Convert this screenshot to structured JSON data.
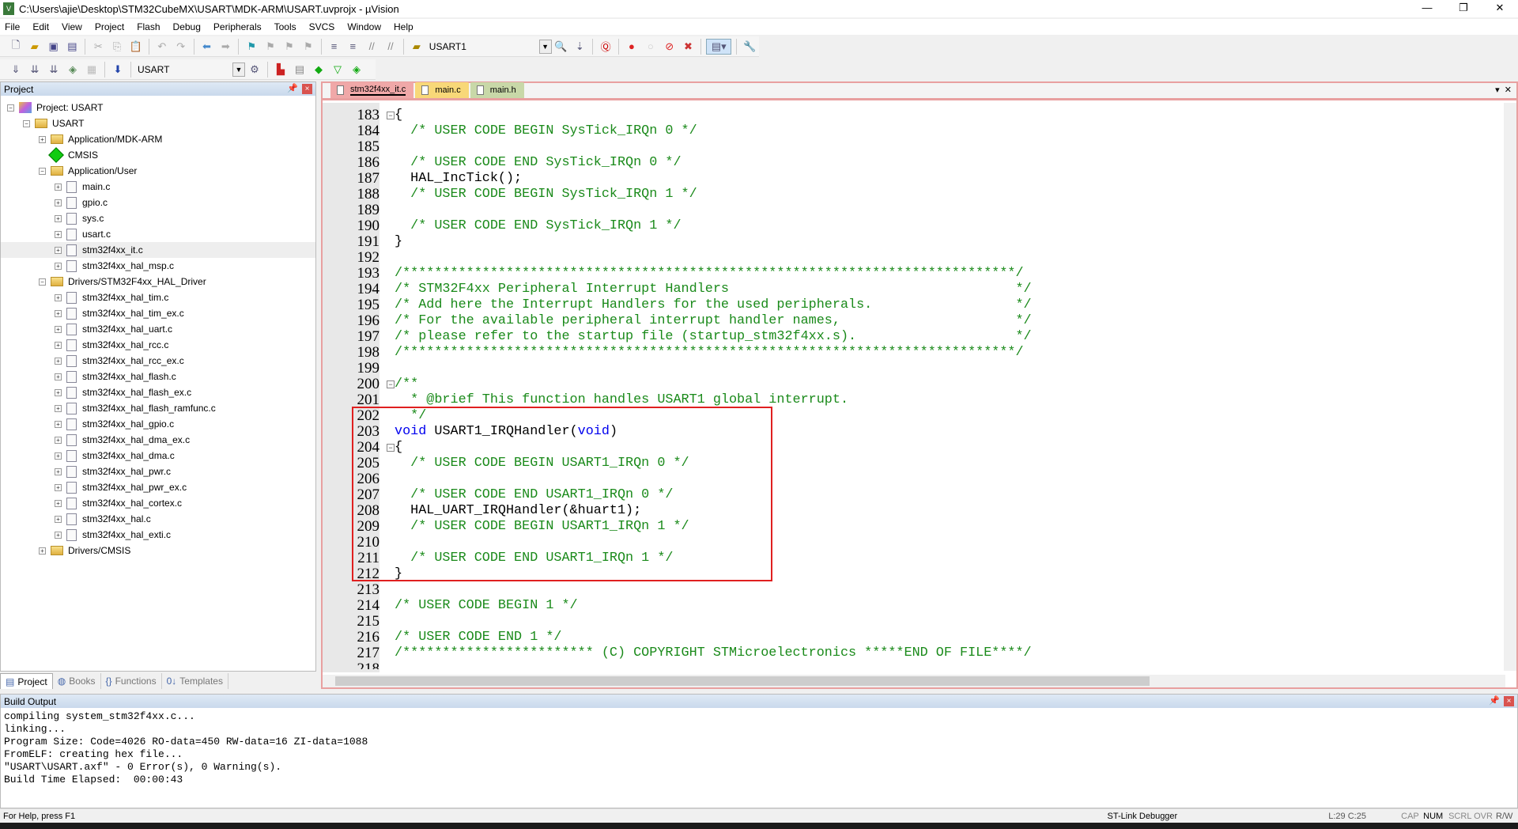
{
  "window": {
    "title": "C:\\Users\\ajie\\Desktop\\STM32CubeMX\\USART\\MDK-ARM\\USART.uvprojx - µVision",
    "minimize": "—",
    "restore": "❐",
    "close": "✕"
  },
  "menu": [
    "File",
    "Edit",
    "View",
    "Project",
    "Flash",
    "Debug",
    "Peripherals",
    "Tools",
    "SVCS",
    "Window",
    "Help"
  ],
  "toolbar1": {
    "target_find": "USART1"
  },
  "toolbar2": {
    "target": "USART"
  },
  "project_panel": {
    "title": "Project",
    "tree": [
      {
        "label": "Project: USART",
        "level": 0,
        "icon": "project",
        "exp": "−"
      },
      {
        "label": "USART",
        "level": 1,
        "icon": "folder",
        "exp": "−"
      },
      {
        "label": "Application/MDK-ARM",
        "level": 2,
        "icon": "folder",
        "exp": "+"
      },
      {
        "label": "CMSIS",
        "level": 2,
        "icon": "cmsis",
        "exp": ""
      },
      {
        "label": "Application/User",
        "level": 2,
        "icon": "folder",
        "exp": "−"
      },
      {
        "label": "main.c",
        "level": 3,
        "icon": "file",
        "exp": "+"
      },
      {
        "label": "gpio.c",
        "level": 3,
        "icon": "file",
        "exp": "+"
      },
      {
        "label": "sys.c",
        "level": 3,
        "icon": "file",
        "exp": "+"
      },
      {
        "label": "usart.c",
        "level": 3,
        "icon": "file",
        "exp": "+"
      },
      {
        "label": "stm32f4xx_it.c",
        "level": 3,
        "icon": "file",
        "exp": "+",
        "selected": true
      },
      {
        "label": "stm32f4xx_hal_msp.c",
        "level": 3,
        "icon": "file",
        "exp": "+"
      },
      {
        "label": "Drivers/STM32F4xx_HAL_Driver",
        "level": 2,
        "icon": "folder",
        "exp": "−"
      },
      {
        "label": "stm32f4xx_hal_tim.c",
        "level": 3,
        "icon": "file",
        "exp": "+"
      },
      {
        "label": "stm32f4xx_hal_tim_ex.c",
        "level": 3,
        "icon": "file",
        "exp": "+"
      },
      {
        "label": "stm32f4xx_hal_uart.c",
        "level": 3,
        "icon": "file",
        "exp": "+"
      },
      {
        "label": "stm32f4xx_hal_rcc.c",
        "level": 3,
        "icon": "file",
        "exp": "+"
      },
      {
        "label": "stm32f4xx_hal_rcc_ex.c",
        "level": 3,
        "icon": "file",
        "exp": "+"
      },
      {
        "label": "stm32f4xx_hal_flash.c",
        "level": 3,
        "icon": "file",
        "exp": "+"
      },
      {
        "label": "stm32f4xx_hal_flash_ex.c",
        "level": 3,
        "icon": "file",
        "exp": "+"
      },
      {
        "label": "stm32f4xx_hal_flash_ramfunc.c",
        "level": 3,
        "icon": "file",
        "exp": "+"
      },
      {
        "label": "stm32f4xx_hal_gpio.c",
        "level": 3,
        "icon": "file",
        "exp": "+"
      },
      {
        "label": "stm32f4xx_hal_dma_ex.c",
        "level": 3,
        "icon": "file",
        "exp": "+"
      },
      {
        "label": "stm32f4xx_hal_dma.c",
        "level": 3,
        "icon": "file",
        "exp": "+"
      },
      {
        "label": "stm32f4xx_hal_pwr.c",
        "level": 3,
        "icon": "file",
        "exp": "+"
      },
      {
        "label": "stm32f4xx_hal_pwr_ex.c",
        "level": 3,
        "icon": "file",
        "exp": "+"
      },
      {
        "label": "stm32f4xx_hal_cortex.c",
        "level": 3,
        "icon": "file",
        "exp": "+"
      },
      {
        "label": "stm32f4xx_hal.c",
        "level": 3,
        "icon": "file",
        "exp": "+"
      },
      {
        "label": "stm32f4xx_hal_exti.c",
        "level": 3,
        "icon": "file",
        "exp": "+"
      },
      {
        "label": "Drivers/CMSIS",
        "level": 2,
        "icon": "folder",
        "exp": "+"
      }
    ]
  },
  "bottom_tabs": [
    {
      "icon": "▤",
      "label": "Project"
    },
    {
      "icon": "◍",
      "label": "Books"
    },
    {
      "icon": "{}",
      "label": "Functions"
    },
    {
      "icon": "0↓",
      "label": "Templates"
    }
  ],
  "editor": {
    "tabs": [
      {
        "label": "stm32f4xx_it.c",
        "color": "#f0a8a8",
        "active": true
      },
      {
        "label": "main.c",
        "color": "#f8d878"
      },
      {
        "label": "main.h",
        "color": "#c8d8a8"
      }
    ],
    "lines": [
      {
        "n": "183",
        "fold": "−",
        "s": [
          [
            "tx",
            "{"
          ]
        ]
      },
      {
        "n": "184",
        "s": [
          [
            "cm",
            "  /* USER CODE BEGIN SysTick_IRQn 0 */"
          ]
        ]
      },
      {
        "n": "185",
        "s": []
      },
      {
        "n": "186",
        "s": [
          [
            "cm",
            "  /* USER CODE END SysTick_IRQn 0 */"
          ]
        ]
      },
      {
        "n": "187",
        "s": [
          [
            "tx",
            "  HAL_IncTick();"
          ]
        ]
      },
      {
        "n": "188",
        "s": [
          [
            "cm",
            "  /* USER CODE BEGIN SysTick_IRQn 1 */"
          ]
        ]
      },
      {
        "n": "189",
        "s": []
      },
      {
        "n": "190",
        "s": [
          [
            "cm",
            "  /* USER CODE END SysTick_IRQn 1 */"
          ]
        ]
      },
      {
        "n": "191",
        "s": [
          [
            "tx",
            "}"
          ]
        ]
      },
      {
        "n": "192",
        "s": []
      },
      {
        "n": "193",
        "s": [
          [
            "cm",
            "/*****************************************************************************/"
          ]
        ]
      },
      {
        "n": "194",
        "s": [
          [
            "cm",
            "/* STM32F4xx Peripheral Interrupt Handlers                                    */"
          ]
        ]
      },
      {
        "n": "195",
        "s": [
          [
            "cm",
            "/* Add here the Interrupt Handlers for the used peripherals.                  */"
          ]
        ]
      },
      {
        "n": "196",
        "s": [
          [
            "cm",
            "/* For the available peripheral interrupt handler names,                      */"
          ]
        ]
      },
      {
        "n": "197",
        "s": [
          [
            "cm",
            "/* please refer to the startup file (startup_stm32f4xx.s).                    */"
          ]
        ]
      },
      {
        "n": "198",
        "s": [
          [
            "cm",
            "/*****************************************************************************/"
          ]
        ]
      },
      {
        "n": "199",
        "s": []
      },
      {
        "n": "200",
        "fold": "−",
        "s": [
          [
            "cm",
            "/**"
          ]
        ]
      },
      {
        "n": "201",
        "s": [
          [
            "cm",
            "  * @brief This function handles USART1 global interrupt."
          ]
        ]
      },
      {
        "n": "202",
        "s": [
          [
            "cm",
            "  */"
          ]
        ]
      },
      {
        "n": "203",
        "s": [
          [
            "kw",
            "void"
          ],
          [
            "tx",
            " USART1_IRQHandler("
          ],
          [
            "kw",
            "void"
          ],
          [
            "tx",
            ")"
          ]
        ]
      },
      {
        "n": "204",
        "fold": "−",
        "s": [
          [
            "tx",
            "{"
          ]
        ]
      },
      {
        "n": "205",
        "s": [
          [
            "cm",
            "  /* USER CODE BEGIN USART1_IRQn 0 */"
          ]
        ]
      },
      {
        "n": "206",
        "s": []
      },
      {
        "n": "207",
        "s": [
          [
            "cm",
            "  /* USER CODE END USART1_IRQn 0 */"
          ]
        ]
      },
      {
        "n": "208",
        "s": [
          [
            "tx",
            "  HAL_UART_IRQHandler(&huart1);"
          ]
        ]
      },
      {
        "n": "209",
        "s": [
          [
            "cm",
            "  /* USER CODE BEGIN USART1_IRQn 1 */"
          ]
        ]
      },
      {
        "n": "210",
        "s": []
      },
      {
        "n": "211",
        "s": [
          [
            "cm",
            "  /* USER CODE END USART1_IRQn 1 */"
          ]
        ]
      },
      {
        "n": "212",
        "s": [
          [
            "tx",
            "}"
          ]
        ]
      },
      {
        "n": "213",
        "s": []
      },
      {
        "n": "214",
        "s": [
          [
            "cm",
            "/* USER CODE BEGIN 1 */"
          ]
        ]
      },
      {
        "n": "215",
        "s": []
      },
      {
        "n": "216",
        "s": [
          [
            "cm",
            "/* USER CODE END 1 */"
          ]
        ]
      },
      {
        "n": "217",
        "s": [
          [
            "cm",
            "/************************ (C) COPYRIGHT STMicroelectronics *****END OF FILE****/"
          ]
        ]
      },
      {
        "n": "218",
        "s": []
      }
    ]
  },
  "build_output": {
    "title": "Build Output",
    "lines": [
      "compiling system_stm32f4xx.c...",
      "linking...",
      "Program Size: Code=4026 RO-data=450 RW-data=16 ZI-data=1088",
      "FromELF: creating hex file...",
      "\"USART\\USART.axf\" - 0 Error(s), 0 Warning(s).",
      "Build Time Elapsed:  00:00:43"
    ]
  },
  "status": {
    "help": "For Help, press F1",
    "debugger": "ST-Link Debugger",
    "position": "L:29 C:25",
    "cap": "CAP",
    "num": "NUM",
    "scrl": "SCRL",
    "ovr": "OVR",
    "rw": "R/W"
  },
  "colors": {
    "comment": "#1a8a1a",
    "keyword": "#0000ee",
    "highlight_box": "#e02020"
  }
}
